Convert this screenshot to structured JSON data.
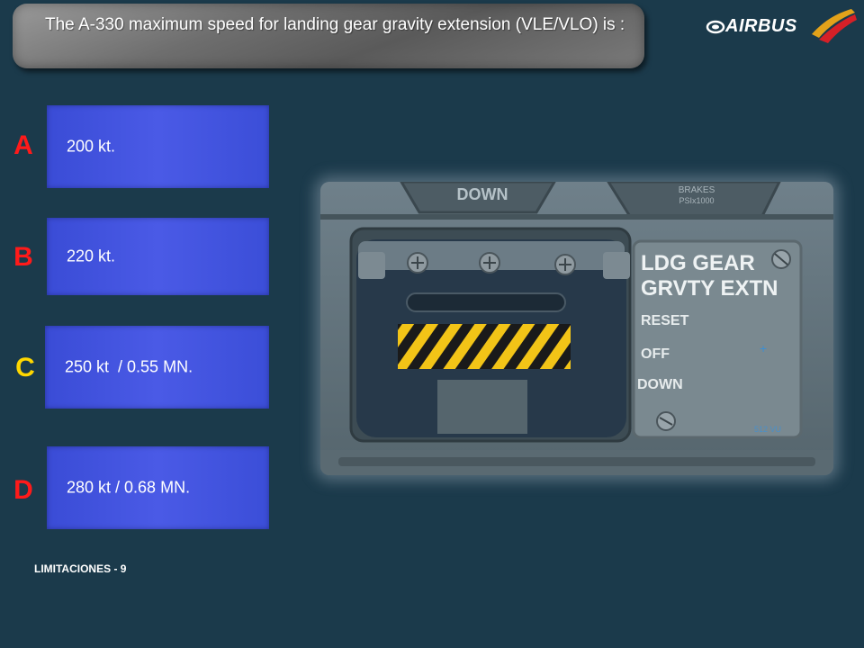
{
  "question": {
    "text": "The A-330 maximum speed for landing gear gravity extension (VLE/VLO) is :"
  },
  "brand": {
    "name": "AIRBUS"
  },
  "answers": [
    {
      "letter": "A",
      "text": "200 kt.",
      "letter_color": "#ff1a1a"
    },
    {
      "letter": "B",
      "text": "220 kt.",
      "letter_color": "#ff1a1a"
    },
    {
      "letter": "C",
      "text": "250 kt  / 0.55 MN.",
      "letter_color": "#ffd700"
    },
    {
      "letter": "D",
      "text": "280 kt / 0.68 MN.",
      "letter_color": "#ff1a1a"
    }
  ],
  "panel_photo": {
    "top_left_label": "DOWN",
    "top_right_label_1": "BRAKES",
    "top_right_label_2": "PSIx1000",
    "placard_line1": "LDG GEAR",
    "placard_line2": "GRVTY EXTN",
    "reset": "RESET",
    "off": "OFF",
    "down": "DOWN",
    "code": "512 VU"
  },
  "footer": {
    "text": "LIMITACIONES - 9"
  },
  "colors": {
    "background": "#1b3a4b",
    "answer_fill": "#4050e0",
    "wrong_letter": "#ff1a1a",
    "correct_letter": "#ffd700"
  }
}
